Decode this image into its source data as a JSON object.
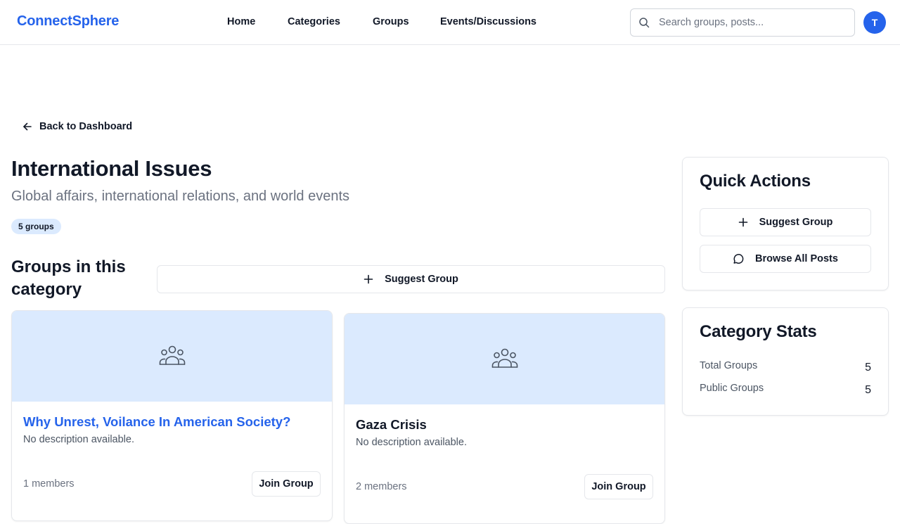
{
  "header": {
    "brand": "ConnectSphere",
    "nav": [
      "Home",
      "Categories",
      "Groups",
      "Events/Discussions"
    ],
    "search_placeholder": "Search groups, posts...",
    "avatar_initial": "T",
    "accent_color": "#2563eb"
  },
  "back_link": {
    "label": "Back to Dashboard",
    "icon": "arrow-left-icon"
  },
  "category": {
    "title": "International Issues",
    "subtitle": "Global affairs, international relations, and world events",
    "count_badge": "5 groups"
  },
  "groups_section": {
    "title": "Groups in this category",
    "suggest_button": "Suggest Group",
    "cards": [
      {
        "title": "Why Unrest, Voilance In American Society?",
        "title_color": "#2563eb",
        "description": "No description available.",
        "members": "1 members",
        "join_label": "Join Group",
        "cover_icon": "users-group-icon"
      },
      {
        "title": "Gaza Crisis",
        "title_color": "#111827",
        "description": "No description available.",
        "members": "2 members",
        "join_label": "Join Group",
        "cover_icon": "users-group-icon"
      }
    ]
  },
  "quick_actions": {
    "title": "Quick Actions",
    "suggest_label": "Suggest Group",
    "browse_label": "Browse All Posts"
  },
  "category_stats": {
    "title": "Category Stats",
    "total_label": "Total Groups",
    "total_value": "5",
    "public_label": "Public Groups",
    "public_value": "5"
  }
}
